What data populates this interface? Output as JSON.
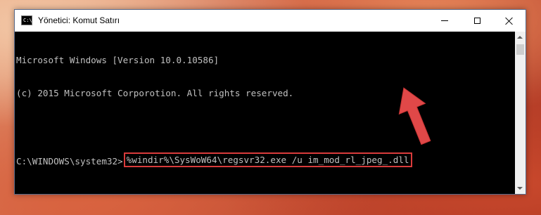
{
  "window": {
    "title": "Yönetici: Komut Satırı",
    "app_icon_glyph": "C:\\",
    "controls": {
      "minimize": "minimize-icon",
      "maximize": "maximize-icon",
      "close": "close-icon"
    }
  },
  "console": {
    "lines": [
      "Microsoft Windows [Version 10.0.10586]",
      "(c) 2015 Microsoft Corporotion. All rights reserved.",
      ""
    ],
    "prompt": "C:\\WINDOWS\\system32>",
    "command": "%windir%\\SysWoW64\\regsvr32.exe /u im_mod_rl_jpeg_.dll"
  },
  "annotations": {
    "highlight_color": "#d93b3b",
    "arrow_color": "#e04848",
    "arrow_icon": "red-arrow-pointer-icon"
  }
}
